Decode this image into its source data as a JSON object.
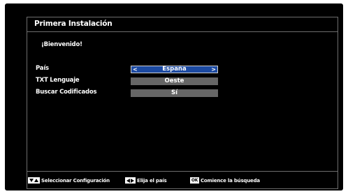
{
  "window": {
    "title": "Primera Instalación"
  },
  "welcome": "¡Bienvenido!",
  "settings": [
    {
      "label": "País",
      "value": "España",
      "selected": true
    },
    {
      "label": "TXT Lenguaje",
      "value": "Oeste",
      "selected": false
    },
    {
      "label": "Buscar Codificados",
      "value": "Sí",
      "selected": false
    }
  ],
  "hints": {
    "nav": {
      "icon": "up-down-arrows-icon",
      "label": "Seleccionar Configuración"
    },
    "country": {
      "icon": "left-right-arrows-icon",
      "label": "Elija el país"
    },
    "ok": {
      "key": "OK",
      "label": "Comience la búsqueda"
    }
  },
  "colors": {
    "background": "#000000",
    "selected": "#1c4aa2",
    "unselected": "#666666",
    "border": "#6e6e6e"
  }
}
